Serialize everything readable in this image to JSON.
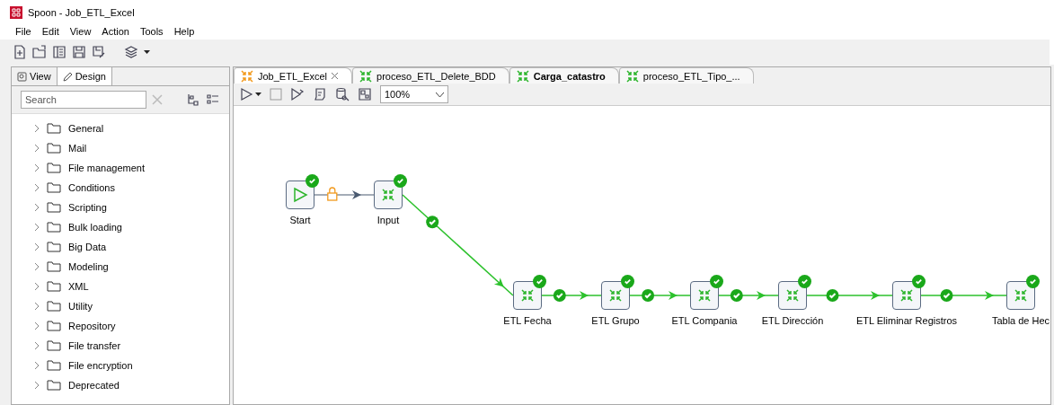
{
  "window": {
    "title": "Spoon - Job_ETL_Excel"
  },
  "menu": [
    "File",
    "Edit",
    "View",
    "Action",
    "Tools",
    "Help"
  ],
  "panel_tabs": [
    {
      "label": "View",
      "selected": false
    },
    {
      "label": "Design",
      "selected": true
    }
  ],
  "search": {
    "placeholder": "Search"
  },
  "tree": [
    {
      "label": "General",
      "expanded": false
    },
    {
      "label": "Mail",
      "expanded": false
    },
    {
      "label": "File management",
      "expanded": false
    },
    {
      "label": "Conditions",
      "expanded": false
    },
    {
      "label": "Scripting",
      "expanded": false
    },
    {
      "label": "Bulk loading",
      "expanded": false
    },
    {
      "label": "Big Data",
      "expanded": false
    },
    {
      "label": "Modeling",
      "expanded": false
    },
    {
      "label": "XML",
      "expanded": false
    },
    {
      "label": "Utility",
      "expanded": false
    },
    {
      "label": "Repository",
      "expanded": false
    },
    {
      "label": "File transfer",
      "expanded": false
    },
    {
      "label": "File encryption",
      "expanded": false
    },
    {
      "label": "Deprecated",
      "expanded": false
    }
  ],
  "editor_tabs": [
    {
      "label": "Job_ETL_Excel",
      "kind": "job",
      "selected": true,
      "changed": false
    },
    {
      "label": "proceso_ETL_Delete_BDD",
      "kind": "transformation",
      "selected": false,
      "changed": false
    },
    {
      "label": "Carga_catastro",
      "kind": "transformation",
      "selected": false,
      "changed": true
    },
    {
      "label": "proceso_ETL_Tipo_...",
      "kind": "transformation",
      "selected": false,
      "changed": false
    }
  ],
  "zoom": "100%",
  "nodes": [
    {
      "label": "Start",
      "kind": "start",
      "ok": true
    },
    {
      "label": "Input",
      "kind": "transformation",
      "ok": true
    },
    {
      "label": "ETL Fecha",
      "kind": "transformation",
      "ok": true
    },
    {
      "label": "ETL Grupo",
      "kind": "transformation",
      "ok": true
    },
    {
      "label": "ETL Compania",
      "kind": "transformation",
      "ok": true
    },
    {
      "label": "ETL Dirección",
      "kind": "transformation",
      "ok": true
    },
    {
      "label": "ETL Eliminar Registros",
      "kind": "transformation",
      "ok": true
    },
    {
      "label": "Tabla de Hec",
      "kind": "transformation",
      "ok": true
    }
  ],
  "hops": [
    {
      "kind": "unconditional"
    },
    {
      "kind": "success"
    },
    {
      "kind": "success"
    },
    {
      "kind": "success"
    },
    {
      "kind": "success"
    },
    {
      "kind": "success"
    },
    {
      "kind": "success"
    }
  ]
}
